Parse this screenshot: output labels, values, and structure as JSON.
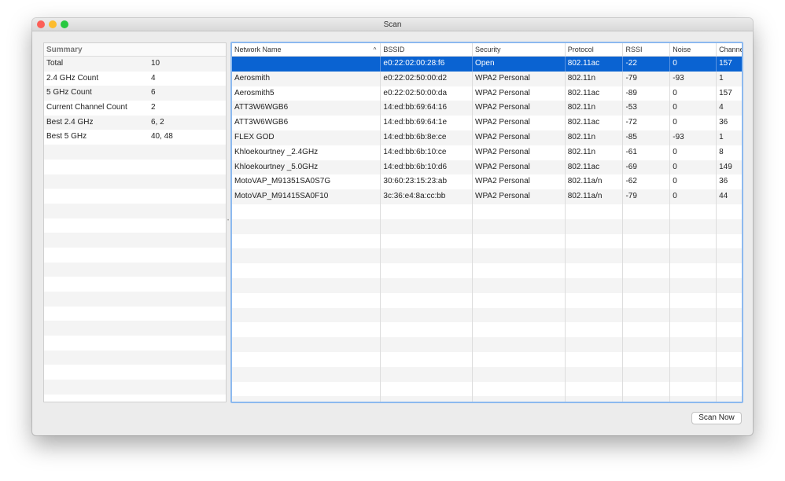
{
  "window": {
    "title": "Scan"
  },
  "summary": {
    "header": "Summary",
    "rows": [
      {
        "label": "Total",
        "value": "10"
      },
      {
        "label": "2.4 GHz Count",
        "value": "4"
      },
      {
        "label": "5 GHz Count",
        "value": "6"
      },
      {
        "label": "Current Channel Count",
        "value": "2"
      },
      {
        "label": "Best 2.4 GHz",
        "value": "6, 2"
      },
      {
        "label": "Best 5 GHz",
        "value": "40, 48"
      }
    ]
  },
  "table": {
    "columns": [
      "Network Name",
      "BSSID",
      "Security",
      "Protocol",
      "RSSI",
      "Noise",
      "Channel"
    ],
    "sort_indicator": "^",
    "rows": [
      [
        "",
        "e0:22:02:00:28:f6",
        "Open",
        "802.11ac",
        "-22",
        "0",
        "157"
      ],
      [
        "Aerosmith",
        "e0:22:02:50:00:d2",
        "WPA2 Personal",
        "802.11n",
        "-79",
        "-93",
        "1"
      ],
      [
        "Aerosmith5",
        "e0:22:02:50:00:da",
        "WPA2 Personal",
        "802.11ac",
        "-89",
        "0",
        "157"
      ],
      [
        "ATT3W6WGB6",
        "14:ed:bb:69:64:16",
        "WPA2 Personal",
        "802.11n",
        "-53",
        "0",
        "4"
      ],
      [
        "ATT3W6WGB6",
        "14:ed:bb:69:64:1e",
        "WPA2 Personal",
        "802.11ac",
        "-72",
        "0",
        "36"
      ],
      [
        "FLEX GOD",
        "14:ed:bb:6b:8e:ce",
        "WPA2 Personal",
        "802.11n",
        "-85",
        "-93",
        "1"
      ],
      [
        "Khloekourtney _2.4GHz",
        "14:ed:bb:6b:10:ce",
        "WPA2 Personal",
        "802.11n",
        "-61",
        "0",
        "8"
      ],
      [
        "Khloekourtney _5.0GHz",
        "14:ed:bb:6b:10:d6",
        "WPA2 Personal",
        "802.11ac",
        "-69",
        "0",
        "149"
      ],
      [
        "MotoVAP_M91351SA0S7G",
        "30:60:23:15:23:ab",
        "WPA2 Personal",
        "802.11a/n",
        "-62",
        "0",
        "36"
      ],
      [
        "MotoVAP_M91415SA0F10",
        "3c:36:e4:8a:cc:bb",
        "WPA2 Personal",
        "802.11a/n",
        "-79",
        "0",
        "44"
      ]
    ],
    "selected_row": 0
  },
  "buttons": {
    "scan_now": "Scan Now"
  }
}
